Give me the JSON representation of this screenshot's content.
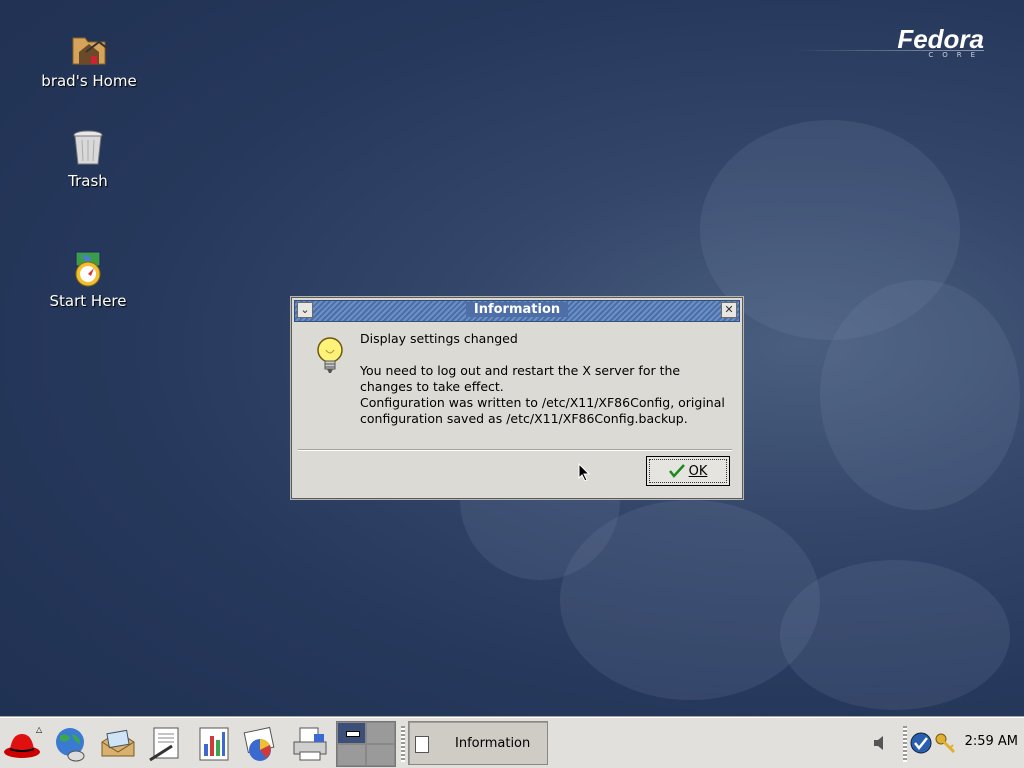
{
  "desktop": {
    "icons": [
      {
        "label": "brad's Home",
        "icon": "home-folder-icon"
      },
      {
        "label": "Trash",
        "icon": "trash-icon"
      },
      {
        "label": "Start Here",
        "icon": "start-here-icon"
      }
    ],
    "logo": {
      "word": "Fedora",
      "sub": "CORE"
    }
  },
  "dialog": {
    "title": "Information",
    "heading": "Display settings changed",
    "body_line1": "You need to log out and restart the X server for the changes to take effect.",
    "body_line2": "Configuration was written to /etc/X11/XF86Config, original configuration saved as /etc/X11/XF86Config.backup.",
    "ok_label": "OK",
    "icon": "lightbulb-icon"
  },
  "panel": {
    "launchers": [
      "redhat-menu-icon",
      "web-browser-icon",
      "email-icon",
      "writer-icon",
      "spreadsheet-icon",
      "presentation-icon",
      "print-manager-icon"
    ],
    "task_label": "Information",
    "clock": "2:59 AM",
    "tray": [
      "volume-icon",
      "update-check-icon",
      "keys-icon"
    ]
  },
  "colors": {
    "accent": "#4a6fa8",
    "desktop": "#26385b",
    "panel": "#e2e0dc"
  }
}
